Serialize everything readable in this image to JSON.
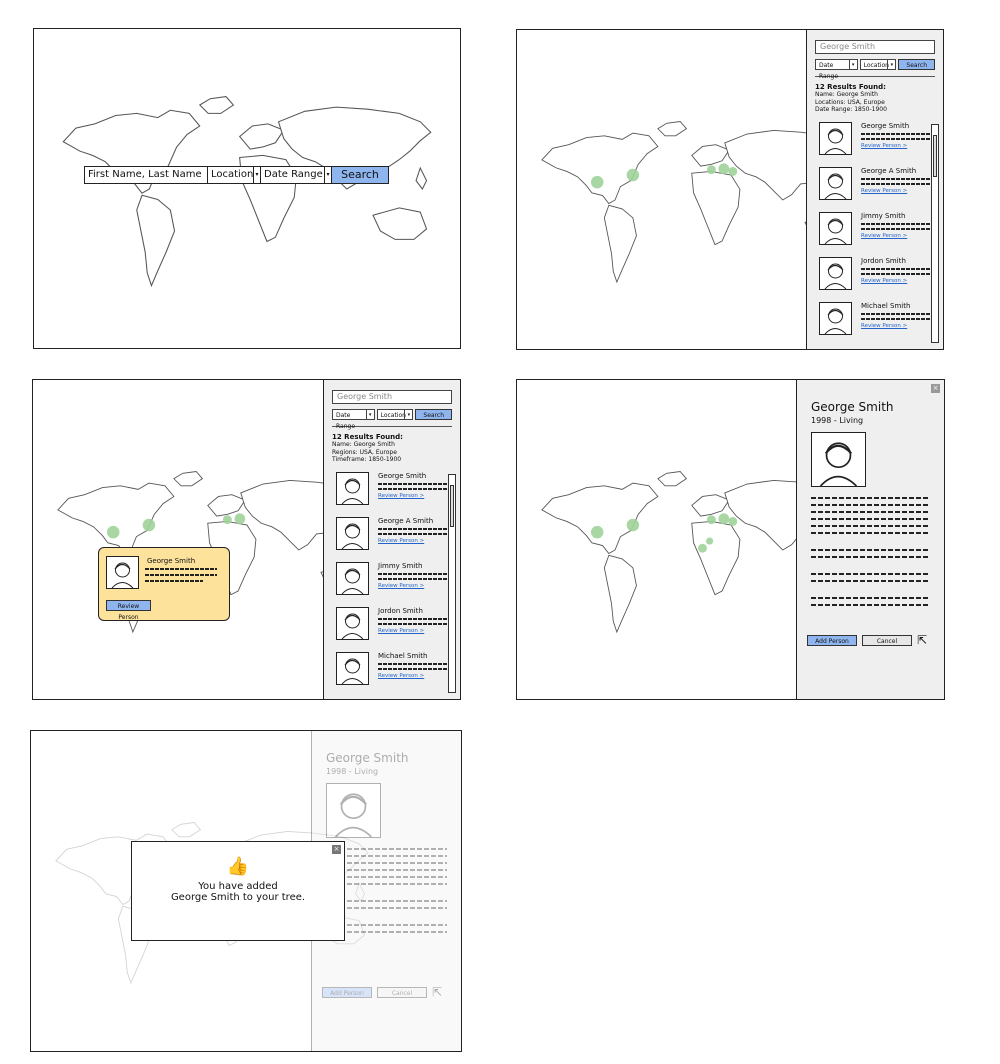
{
  "panel1": {
    "search": {
      "name_placeholder": "First Name, Last Name",
      "location_label": "Location",
      "date_label": "Date Range",
      "search_label": "Search"
    }
  },
  "panel2": {
    "search_value": "George Smith",
    "filter1": "Date Range",
    "filter2": "Location",
    "search_label": "Search",
    "results_title": "12 Results Found:",
    "meta": [
      "Name: George Smith",
      "Locations: USA, Europe",
      "Date Range: 1850-1900"
    ],
    "results": [
      {
        "name": "George Smith",
        "link": "Review Person >"
      },
      {
        "name": "George A Smith",
        "link": "Review Person >"
      },
      {
        "name": "Jimmy Smith",
        "link": "Review Person >"
      },
      {
        "name": "Jordon Smith",
        "link": "Review Person >"
      },
      {
        "name": "Michael Smith",
        "link": "Review Person >"
      }
    ]
  },
  "panel3": {
    "search_value": "George Smith",
    "filter1": "Date Range",
    "filter2": "Location",
    "search_label": "Search",
    "results_title": "12 Results Found:",
    "meta": [
      "Name: George Smith",
      "Regions: USA, Europe",
      "Timeframe: 1850-1900"
    ],
    "popup": {
      "name": "George Smith",
      "button": "Review Person"
    },
    "results": [
      {
        "name": "George Smith",
        "link": "Review Person >"
      },
      {
        "name": "George A Smith",
        "link": "Review Person >"
      },
      {
        "name": "Jimmy Smith",
        "link": "Review Person >"
      },
      {
        "name": "Jordon Smith",
        "link": "Review Person >"
      },
      {
        "name": "Michael Smith",
        "link": "Review Person >"
      }
    ]
  },
  "panel4": {
    "title": "George Smith",
    "subtitle": "1998 - Living",
    "add_label": "Add Person",
    "cancel_label": "Cancel",
    "close_label": "×"
  },
  "panel5": {
    "title": "George Smith",
    "subtitle": "1998 - Living",
    "add_label": "Add Person",
    "cancel_label": "Cancel",
    "modal_line1": "You have added",
    "modal_line2": "George Smith to your tree.",
    "close_label": "×"
  },
  "colors": {
    "accent": "#8fb5ef",
    "dot": "#9fd39a",
    "popup": "#fce29a",
    "link": "#2463c9"
  }
}
